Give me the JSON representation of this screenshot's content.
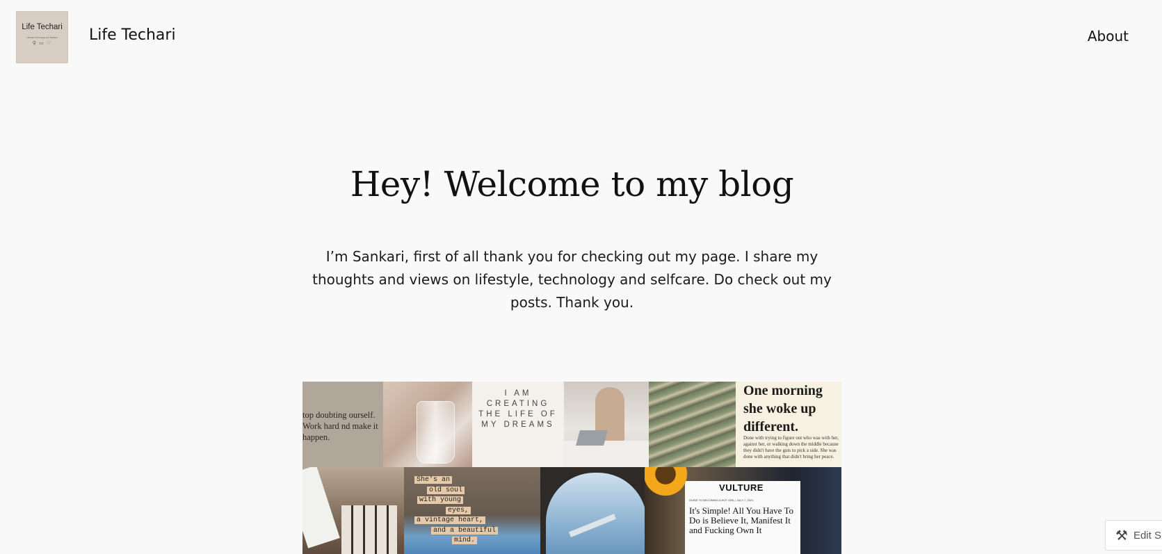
{
  "header": {
    "logo": {
      "text": "Life Techari",
      "subtext": "Lifestyle Technology and Selfcare",
      "icons": "♀ ▭ ♡"
    },
    "site_title": "Life Techari",
    "nav": [
      {
        "label": "About"
      }
    ]
  },
  "hero": {
    "title": "Hey! Welcome to my blog",
    "intro": "I’m Sankari, first of all thank you for checking out my page. I share my thoughts and views on lifestyle, technology and selfcare. Do check out my posts. Thank you."
  },
  "collage": {
    "quote_tile": "top doubting ourself. Work hard nd make it happen.",
    "dreams_tile": "I AM CREATING THE LIFE OF MY DREAMS",
    "woke_tile": {
      "headline": "One morning she woke up different.",
      "body": "Done with trying to figure out who was with her, against her, or walking down the middle because they didn't have the guts to pick a side. She was done with anything that didn't bring her peace."
    },
    "soul_tile": [
      "She's an",
      "old soul",
      "with young",
      "eyes,",
      "a vintage heart,",
      "and a beautiful",
      "mind."
    ],
    "vulture_tile": {
      "masthead": "VULTURE",
      "kicker": "GUIDE TO BECOMING A HOT GIRL | JULY 7, 2021",
      "headline": "It's Simple! All You Have To Do is Believe It, Manifest It and Fucking Own It"
    }
  },
  "edit_button": {
    "label": "Edit S",
    "icon": "tools-icon"
  }
}
